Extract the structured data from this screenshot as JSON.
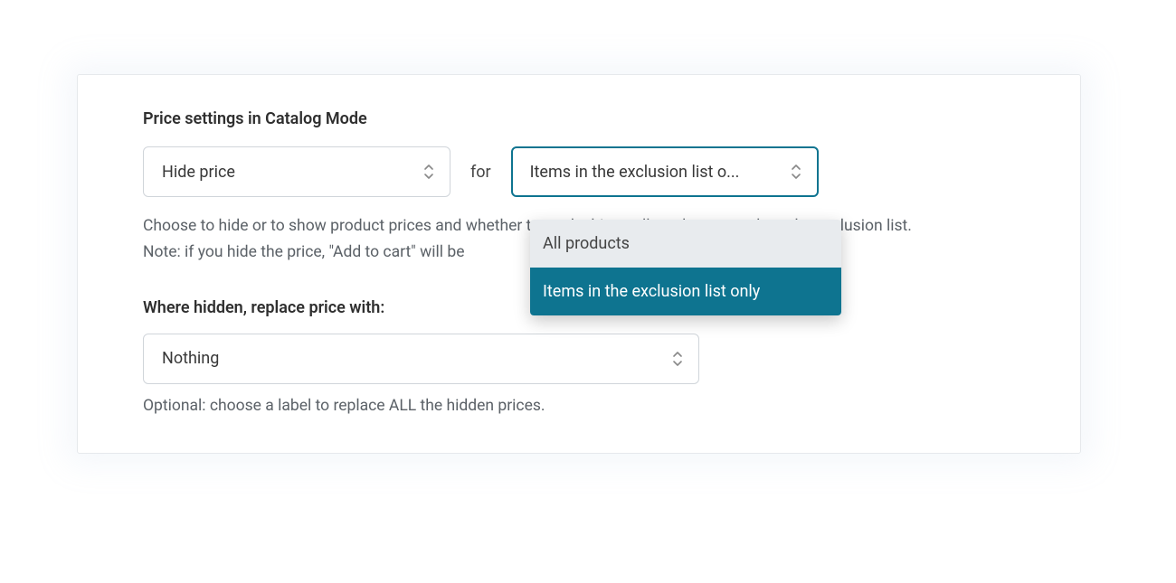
{
  "section_title": "Price settings in Catalog Mode",
  "hide_select": {
    "value": "Hide price"
  },
  "for_label": "for",
  "scope_select": {
    "value": "Items in the exclusion list o..."
  },
  "description_line1": "Choose to hide or to show product prices and whether to apply this to all products or only to the exclusion list.",
  "description_line2": "Note: if you hide the price, \"Add to cart\" will be",
  "replace_title": "Where hidden, replace price with:",
  "replace_select": {
    "value": "Nothing"
  },
  "replace_description": "Optional: choose a label to replace ALL the hidden prices.",
  "dropdown": {
    "option1": "All products",
    "option2": "Items in the exclusion list only"
  }
}
